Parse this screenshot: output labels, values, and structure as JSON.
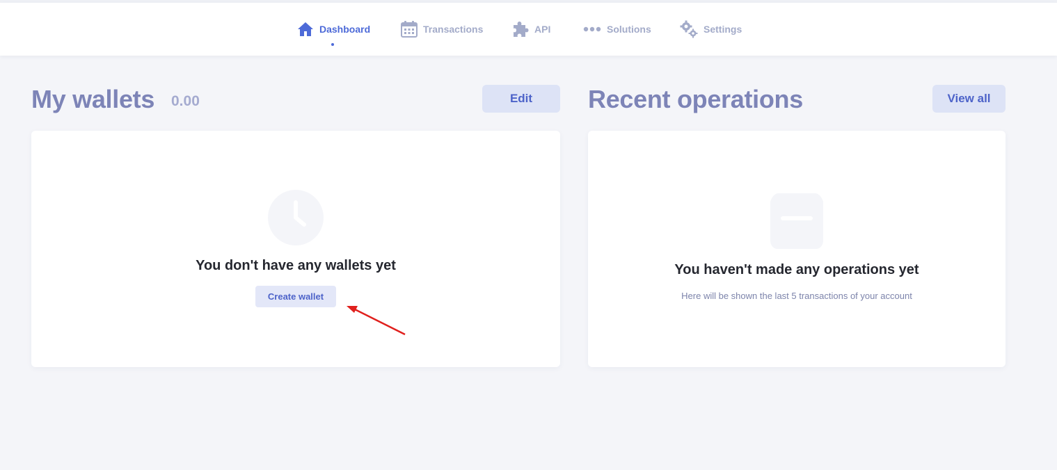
{
  "nav": {
    "items": [
      {
        "label": "Dashboard",
        "icon": "home-icon",
        "active": true
      },
      {
        "label": "Transactions",
        "icon": "calendar-icon",
        "active": false
      },
      {
        "label": "API",
        "icon": "puzzle-icon",
        "active": false
      },
      {
        "label": "Solutions",
        "icon": "dots-icon",
        "active": false
      },
      {
        "label": "Settings",
        "icon": "gears-icon",
        "active": false
      }
    ]
  },
  "wallets": {
    "title": "My wallets",
    "balance": "0.00",
    "edit_label": "Edit",
    "empty_title": "You don't have any wallets yet",
    "create_label": "Create wallet"
  },
  "operations": {
    "title": "Recent operations",
    "view_all_label": "View all",
    "empty_title": "You haven't made any operations yet",
    "empty_subtitle": "Here will be shown the last 5 transactions of your account"
  },
  "colors": {
    "accent": "#4d6ad8",
    "nav_inactive": "#a3abc9",
    "title": "#7d84b7",
    "button_bg": "#dde3f6",
    "annotation_arrow": "#e0201d"
  }
}
